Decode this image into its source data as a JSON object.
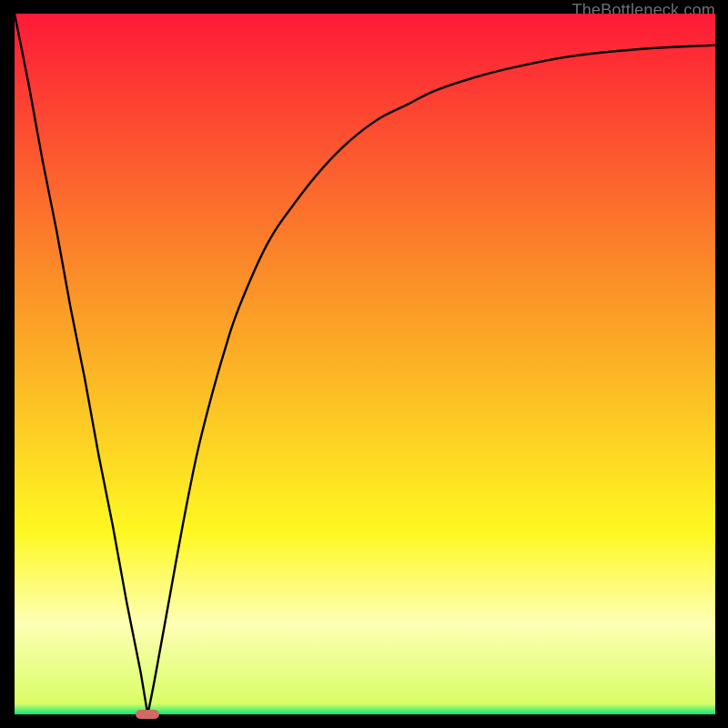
{
  "watermark": "TheBottleneck.com",
  "colors": {
    "gradient_top": "#fe1a37",
    "gradient_mid1": "#fb8f28",
    "gradient_mid2": "#fef821",
    "gradient_mid3": "#feffb5",
    "gradient_bottom": "#05e77b",
    "curve": "#000000",
    "marker": "#cf6a66",
    "frame": "#000000"
  },
  "chart_data": {
    "type": "line",
    "title": "",
    "xlabel": "",
    "ylabel": "",
    "xlim": [
      0,
      100
    ],
    "ylim": [
      0,
      100
    ],
    "grid": false,
    "legend": null,
    "series": [
      {
        "name": "bottleneck-curve",
        "x": [
          0,
          2,
          4,
          6,
          8,
          10,
          12,
          14,
          16,
          18,
          19,
          20,
          22,
          24,
          26,
          28,
          30,
          32,
          36,
          40,
          44,
          48,
          52,
          56,
          60,
          66,
          72,
          80,
          90,
          100
        ],
        "y": [
          100,
          90,
          79,
          69,
          58,
          48,
          37,
          27,
          16,
          6,
          0,
          5,
          16,
          27,
          37,
          45,
          52,
          58,
          67,
          73,
          78,
          82,
          85,
          87,
          89,
          91,
          92.5,
          94,
          95,
          95.5
        ]
      }
    ],
    "marker": {
      "x": 19,
      "y": 0,
      "width_pct": 3.4,
      "height_pct": 1.4,
      "color": "#cf6a66"
    },
    "background_gradient": {
      "stops": [
        {
          "pos": 0.0,
          "color": "#fe1a37"
        },
        {
          "pos": 0.38,
          "color": "#fb8f28"
        },
        {
          "pos": 0.74,
          "color": "#fef821"
        },
        {
          "pos": 0.87,
          "color": "#feffb5"
        },
        {
          "pos": 0.985,
          "color": "#d9fd66"
        },
        {
          "pos": 1.0,
          "color": "#05e77b"
        }
      ]
    }
  }
}
